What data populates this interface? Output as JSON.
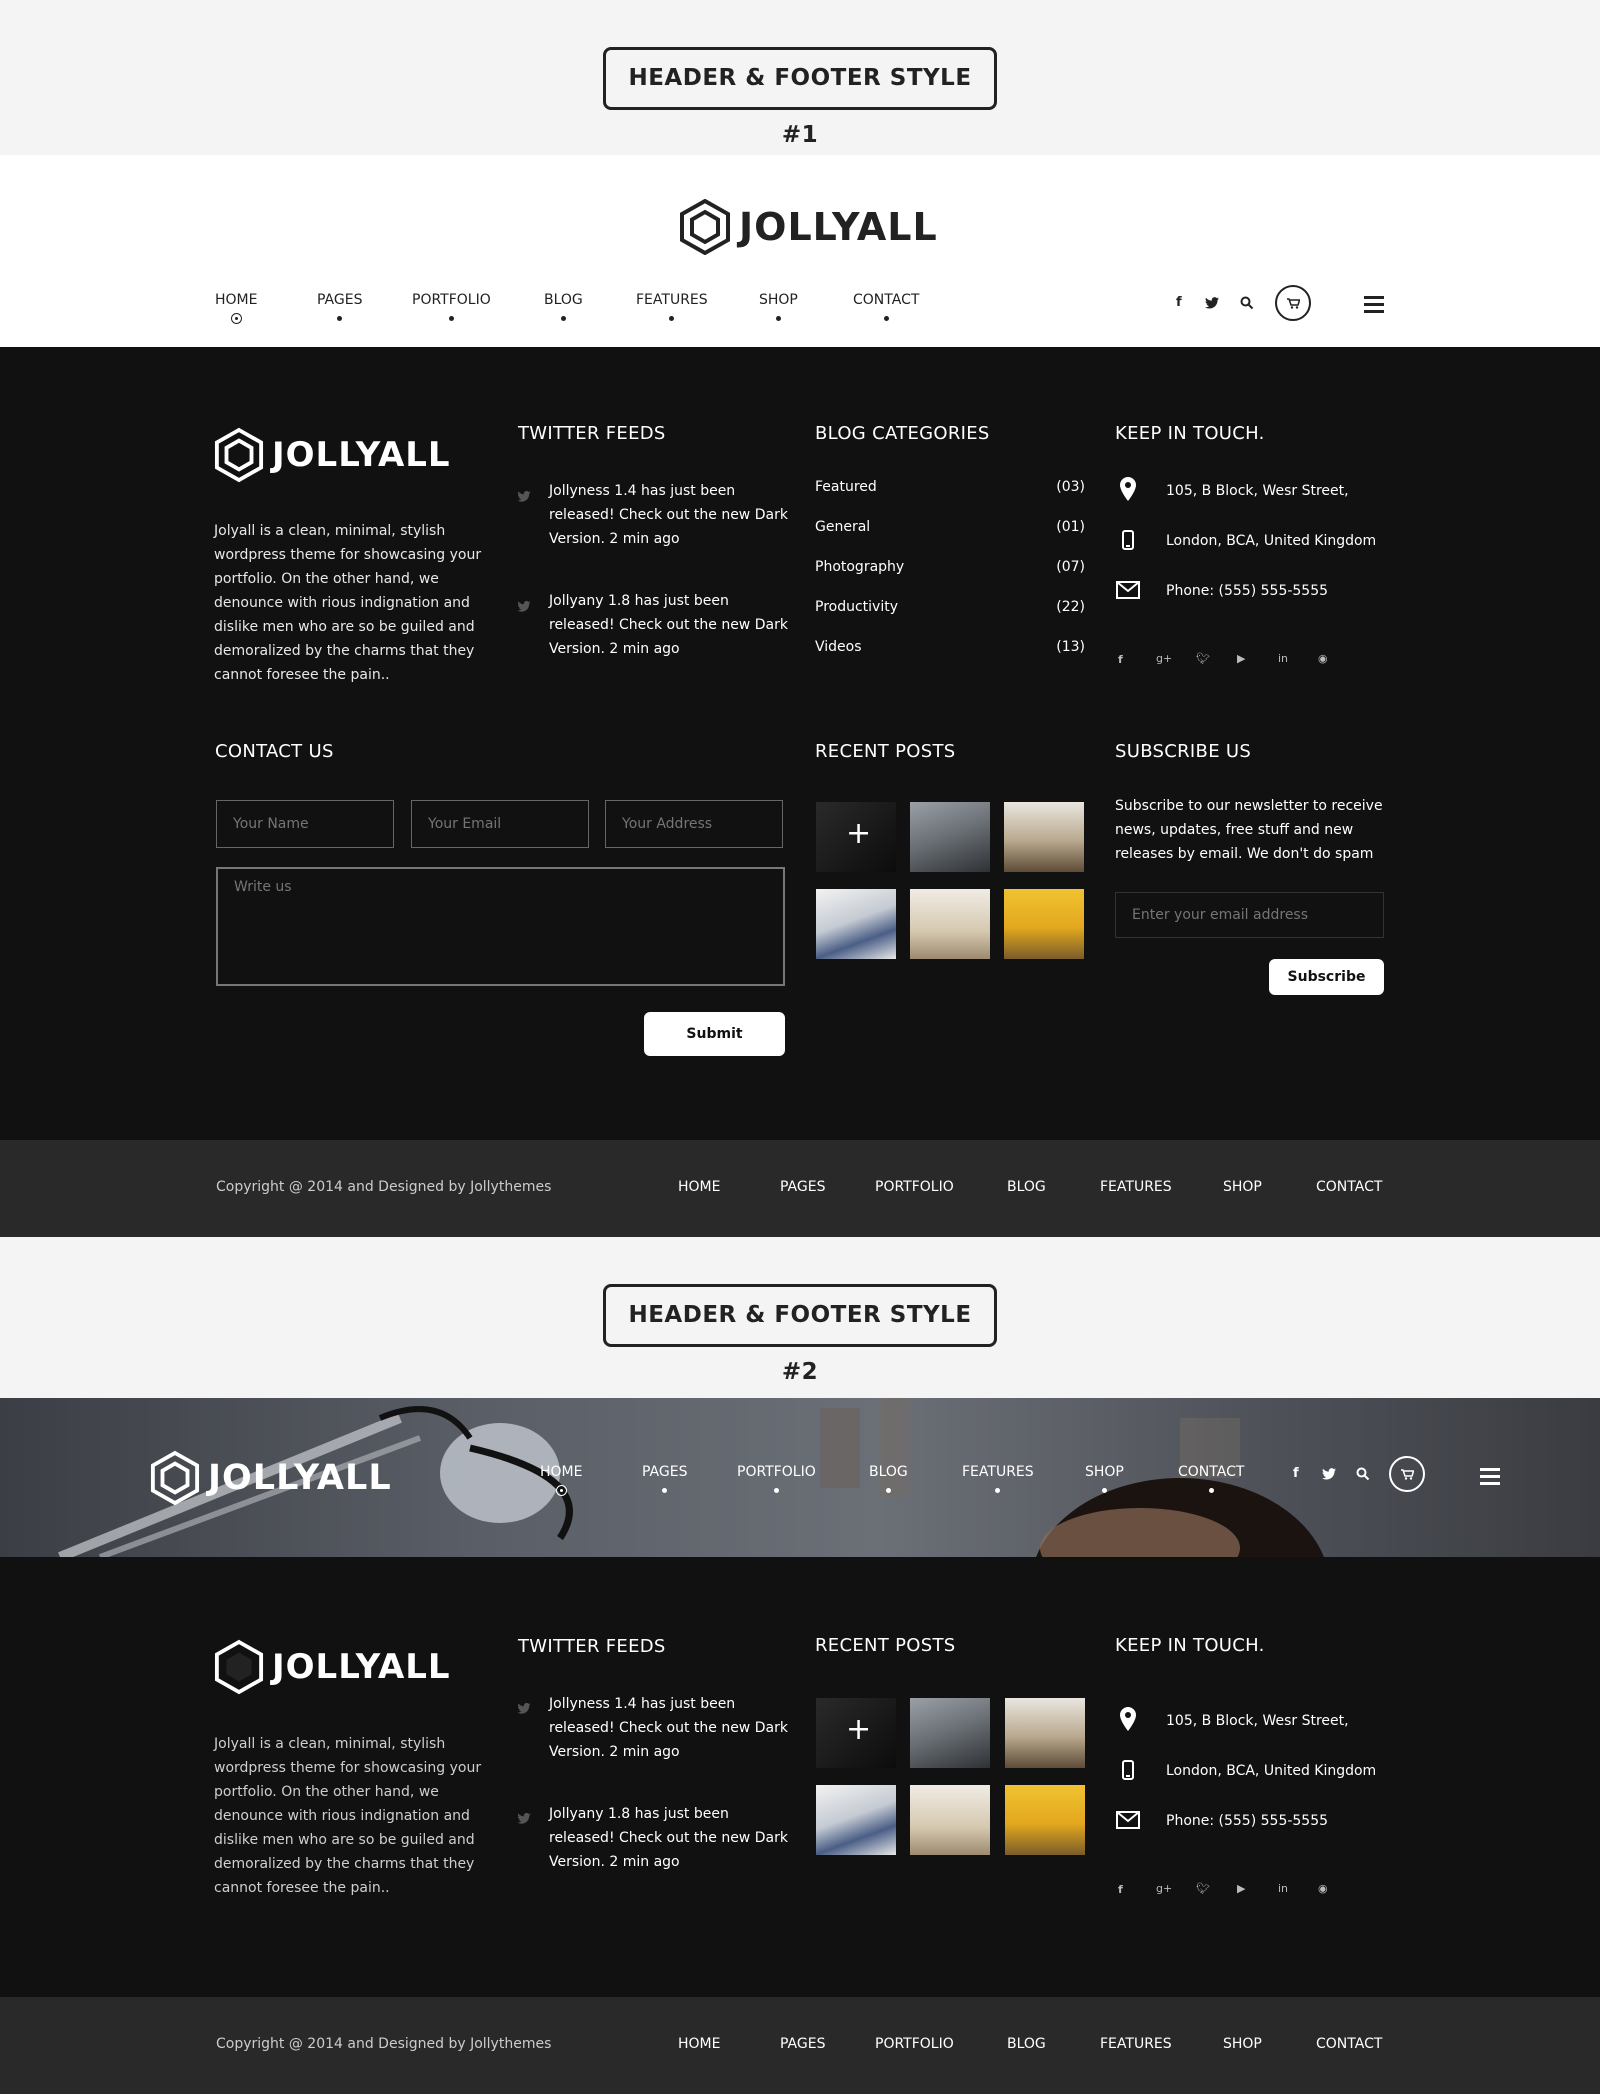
{
  "banner1": {
    "label": "HEADER & FOOTER STYLE #1"
  },
  "banner2": {
    "label": "HEADER & FOOTER STYLE #2"
  },
  "brand": {
    "name": "JOLLYALL"
  },
  "nav": [
    "HOME",
    "PAGES",
    "PORTFOLIO",
    "BLOG",
    "FEATURES",
    "SHOP",
    "CONTACT"
  ],
  "header_icons": [
    "facebook-icon",
    "twitter-icon",
    "search-icon",
    "cart-icon",
    "menu-icon"
  ],
  "about": {
    "text": "Jolyall  is a clean, minimal, stylish wordpress theme for showcasing your portfolio. On the other hand, we denounce with rious indignation and dislike men who are so be guiled and demoralized by the charms that they cannot foresee the pain.."
  },
  "twitter": {
    "title": "TWITTER FEEDS",
    "tweets": [
      "Jollyness 1.4 has just been released! Check out the new Dark Version. 2 min ago",
      "Jollyany 1.8 has just been released! Check out the new Dark Version. 2 min ago"
    ]
  },
  "categories": {
    "title": "BLOG CATEGORIES",
    "items": [
      {
        "name": "Featured",
        "count": "(03)"
      },
      {
        "name": "General",
        "count": "(01)"
      },
      {
        "name": "Photography",
        "count": "(07)"
      },
      {
        "name": "Productivity",
        "count": "(22)"
      },
      {
        "name": "Videos",
        "count": "(13)"
      }
    ]
  },
  "touch": {
    "title": "KEEP IN TOUCH.",
    "address1": "105, B Block,  Wesr Street,",
    "address2": "London, BCA, United Kingdom",
    "phone": "Phone: (555) 555-5555",
    "socials": [
      "facebook-icon",
      "google-plus-icon",
      "twitter-icon",
      "youtube-icon",
      "linkedin-icon",
      "dribbble-icon"
    ]
  },
  "contact": {
    "title": "CONTACT US",
    "name_placeholder": "Your Name",
    "email_placeholder": "Your Email",
    "address_placeholder": "Your Address",
    "message_placeholder": "Write us",
    "submit": "Submit"
  },
  "recent": {
    "title": "RECENT POSTS",
    "plus": "+"
  },
  "subscribe": {
    "title": "SUBSCRIBE US",
    "text": "Subscribe to our newsletter to receive news, updates, free stuff and new releases by email. We don't do spam",
    "placeholder": "Enter your email address",
    "button": "Subscribe"
  },
  "footer": {
    "copyright": "Copyright @ 2014 and Designed by Jollythemes"
  },
  "colors": {
    "dark": "#111111",
    "bar": "#292929",
    "light": "#f4f4f4"
  }
}
